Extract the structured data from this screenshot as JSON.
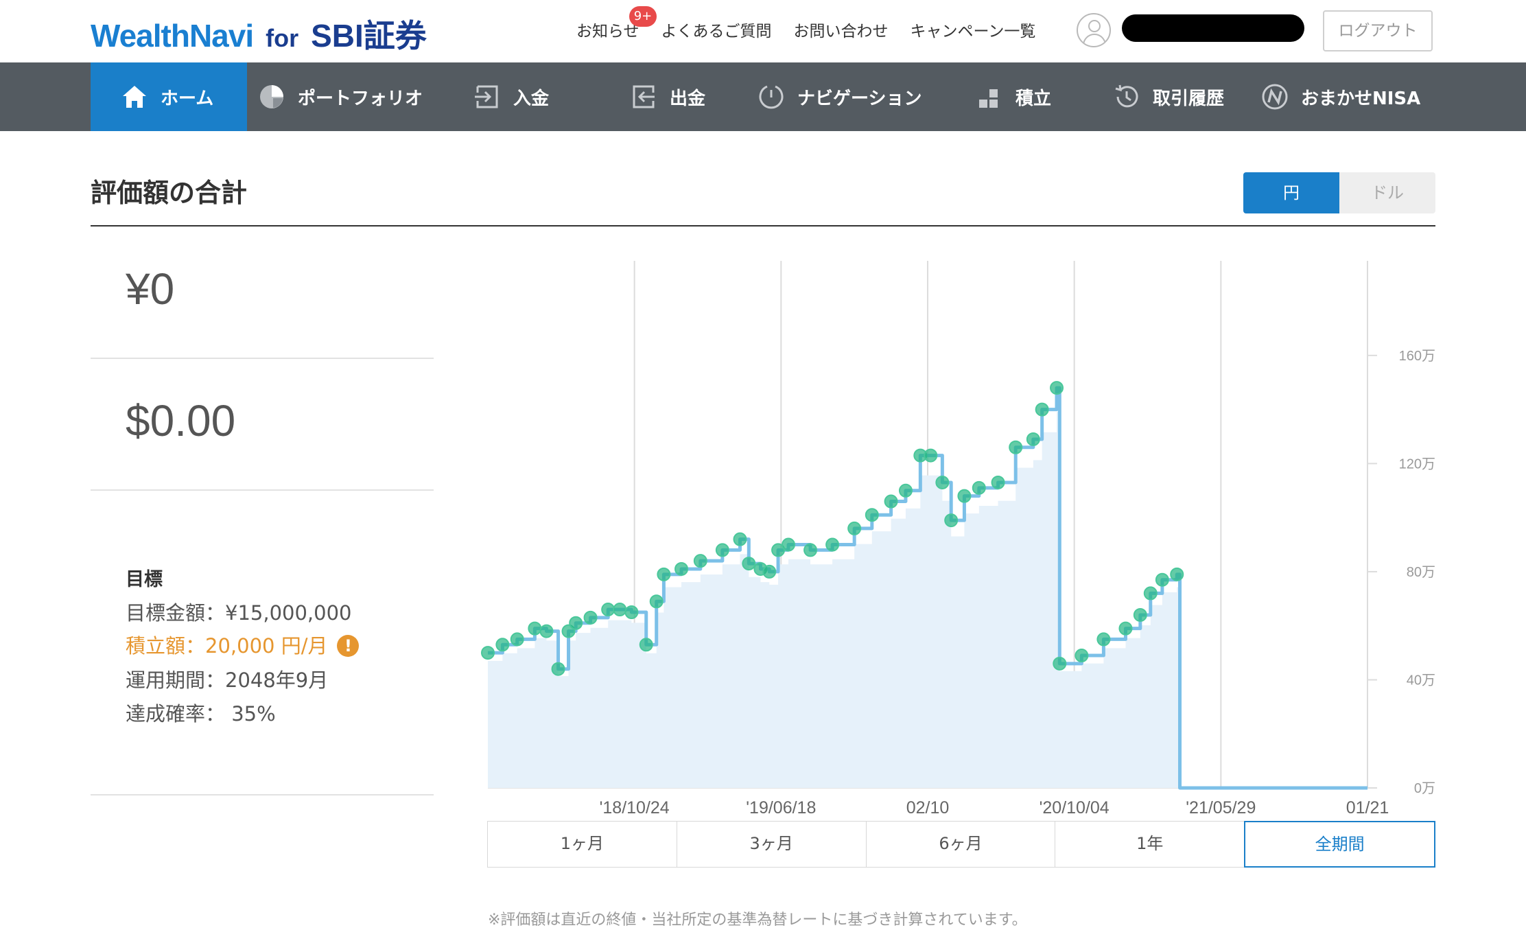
{
  "header": {
    "logo_main": "WealthNavi",
    "logo_for": "for",
    "logo_sbi": "SBI証券",
    "links": [
      "お知らせ",
      "よくあるご質問",
      "お問い合わせ",
      "キャンペーン一覧"
    ],
    "notification_badge": "9+",
    "logout_label": "ログアウト"
  },
  "nav": {
    "items": [
      {
        "label": "ホーム",
        "icon": "home-icon",
        "active": true
      },
      {
        "label": "ポートフォリオ",
        "icon": "pie-chart-icon"
      },
      {
        "label": "入金",
        "icon": "deposit-icon"
      },
      {
        "label": "出金",
        "icon": "withdraw-icon"
      },
      {
        "label": "ナビゲーション",
        "icon": "navigation-icon"
      },
      {
        "label": "積立",
        "icon": "blocks-icon"
      },
      {
        "label": "取引履歴",
        "icon": "history-icon"
      },
      {
        "label": "おまかせNISA",
        "icon": "nisa-icon"
      }
    ]
  },
  "summary": {
    "title": "評価額の合計",
    "currency_toggle": {
      "yen": "円",
      "dollar": "ドル",
      "selected": "円"
    },
    "yen_value": "¥0",
    "usd_value": "$0.00"
  },
  "goal": {
    "title": "目標",
    "target_amount": "目標金額：¥15,000,000",
    "monthly_contribution": "積立額：20,000 円/月",
    "period": "運用期間：2048年9月",
    "probability": "達成確率： 35%"
  },
  "colors": {
    "accent": "#1a7fc9",
    "nav_bg": "#545b61",
    "line": "#7cc0e8",
    "marker": "#22b582",
    "area": "#e6f1fa",
    "warning": "#e6962f"
  },
  "chart_data": {
    "type": "area",
    "y_unit": "万",
    "y_ticks": [
      "0万",
      "40万",
      "80万",
      "120万",
      "160万"
    ],
    "ylim": [
      0,
      195
    ],
    "x_ticks": [
      "'18/10/24",
      "'19/06/18",
      "02/10",
      "'20/10/04",
      "'21/05/29",
      "01/21"
    ],
    "xlim_index": [
      -1.0,
      5.0
    ],
    "grid": "vertical",
    "series": [
      {
        "points": [
          [
            -1.0,
            50
          ],
          [
            -0.9,
            53
          ],
          [
            -0.8,
            55
          ],
          [
            -0.68,
            59
          ],
          [
            -0.6,
            58
          ],
          [
            -0.52,
            44
          ],
          [
            -0.45,
            58
          ],
          [
            -0.4,
            61
          ],
          [
            -0.3,
            63
          ],
          [
            -0.18,
            66
          ],
          [
            -0.1,
            66
          ],
          [
            -0.02,
            65
          ],
          [
            0.08,
            53
          ],
          [
            0.15,
            69
          ],
          [
            0.2,
            79
          ],
          [
            0.32,
            81
          ],
          [
            0.45,
            84
          ],
          [
            0.6,
            88
          ],
          [
            0.72,
            92
          ],
          [
            0.78,
            83
          ],
          [
            0.86,
            81
          ],
          [
            0.92,
            80
          ],
          [
            0.98,
            88
          ],
          [
            1.05,
            90
          ],
          [
            1.2,
            88
          ],
          [
            1.35,
            90
          ],
          [
            1.5,
            96
          ],
          [
            1.62,
            101
          ],
          [
            1.75,
            106
          ],
          [
            1.85,
            110
          ],
          [
            1.95,
            123
          ],
          [
            2.02,
            123
          ],
          [
            2.1,
            113
          ],
          [
            2.16,
            99
          ],
          [
            2.25,
            108
          ],
          [
            2.35,
            111
          ],
          [
            2.48,
            113
          ],
          [
            2.6,
            126
          ],
          [
            2.72,
            129
          ],
          [
            2.78,
            140
          ],
          [
            2.88,
            148
          ],
          [
            2.9,
            46
          ],
          [
            3.05,
            49
          ],
          [
            3.2,
            55
          ],
          [
            3.35,
            59
          ],
          [
            3.45,
            64
          ],
          [
            3.52,
            72
          ],
          [
            3.6,
            77
          ],
          [
            3.7,
            79
          ],
          [
            3.72,
            0
          ],
          [
            5.0,
            0
          ]
        ]
      }
    ]
  },
  "periods": [
    "1ヶ月",
    "3ヶ月",
    "6ヶ月",
    "1年",
    "全期間"
  ],
  "selected_period": "全期間",
  "footnote": "※評価額は直近の終値・当社所定の基準為替レートに基づき計算されています。"
}
